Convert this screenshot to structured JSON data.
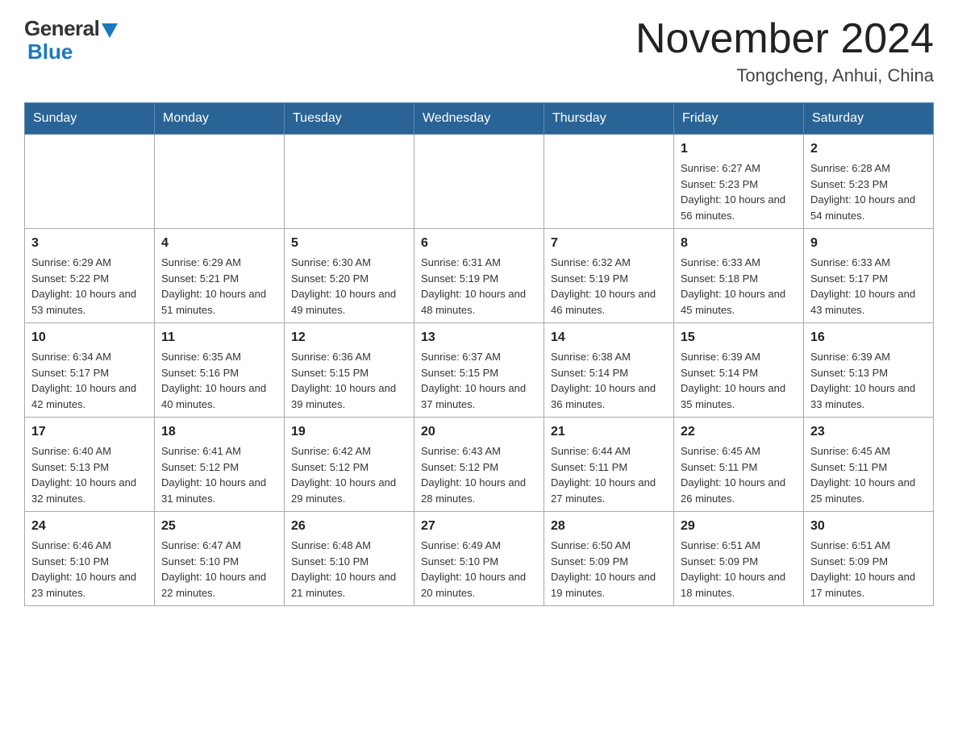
{
  "header": {
    "logo_general": "General",
    "logo_blue": "Blue",
    "month_title": "November 2024",
    "location": "Tongcheng, Anhui, China"
  },
  "weekdays": [
    "Sunday",
    "Monday",
    "Tuesday",
    "Wednesday",
    "Thursday",
    "Friday",
    "Saturday"
  ],
  "weeks": [
    [
      {
        "day": "",
        "info": ""
      },
      {
        "day": "",
        "info": ""
      },
      {
        "day": "",
        "info": ""
      },
      {
        "day": "",
        "info": ""
      },
      {
        "day": "",
        "info": ""
      },
      {
        "day": "1",
        "info": "Sunrise: 6:27 AM\nSunset: 5:23 PM\nDaylight: 10 hours and 56 minutes."
      },
      {
        "day": "2",
        "info": "Sunrise: 6:28 AM\nSunset: 5:23 PM\nDaylight: 10 hours and 54 minutes."
      }
    ],
    [
      {
        "day": "3",
        "info": "Sunrise: 6:29 AM\nSunset: 5:22 PM\nDaylight: 10 hours and 53 minutes."
      },
      {
        "day": "4",
        "info": "Sunrise: 6:29 AM\nSunset: 5:21 PM\nDaylight: 10 hours and 51 minutes."
      },
      {
        "day": "5",
        "info": "Sunrise: 6:30 AM\nSunset: 5:20 PM\nDaylight: 10 hours and 49 minutes."
      },
      {
        "day": "6",
        "info": "Sunrise: 6:31 AM\nSunset: 5:19 PM\nDaylight: 10 hours and 48 minutes."
      },
      {
        "day": "7",
        "info": "Sunrise: 6:32 AM\nSunset: 5:19 PM\nDaylight: 10 hours and 46 minutes."
      },
      {
        "day": "8",
        "info": "Sunrise: 6:33 AM\nSunset: 5:18 PM\nDaylight: 10 hours and 45 minutes."
      },
      {
        "day": "9",
        "info": "Sunrise: 6:33 AM\nSunset: 5:17 PM\nDaylight: 10 hours and 43 minutes."
      }
    ],
    [
      {
        "day": "10",
        "info": "Sunrise: 6:34 AM\nSunset: 5:17 PM\nDaylight: 10 hours and 42 minutes."
      },
      {
        "day": "11",
        "info": "Sunrise: 6:35 AM\nSunset: 5:16 PM\nDaylight: 10 hours and 40 minutes."
      },
      {
        "day": "12",
        "info": "Sunrise: 6:36 AM\nSunset: 5:15 PM\nDaylight: 10 hours and 39 minutes."
      },
      {
        "day": "13",
        "info": "Sunrise: 6:37 AM\nSunset: 5:15 PM\nDaylight: 10 hours and 37 minutes."
      },
      {
        "day": "14",
        "info": "Sunrise: 6:38 AM\nSunset: 5:14 PM\nDaylight: 10 hours and 36 minutes."
      },
      {
        "day": "15",
        "info": "Sunrise: 6:39 AM\nSunset: 5:14 PM\nDaylight: 10 hours and 35 minutes."
      },
      {
        "day": "16",
        "info": "Sunrise: 6:39 AM\nSunset: 5:13 PM\nDaylight: 10 hours and 33 minutes."
      }
    ],
    [
      {
        "day": "17",
        "info": "Sunrise: 6:40 AM\nSunset: 5:13 PM\nDaylight: 10 hours and 32 minutes."
      },
      {
        "day": "18",
        "info": "Sunrise: 6:41 AM\nSunset: 5:12 PM\nDaylight: 10 hours and 31 minutes."
      },
      {
        "day": "19",
        "info": "Sunrise: 6:42 AM\nSunset: 5:12 PM\nDaylight: 10 hours and 29 minutes."
      },
      {
        "day": "20",
        "info": "Sunrise: 6:43 AM\nSunset: 5:12 PM\nDaylight: 10 hours and 28 minutes."
      },
      {
        "day": "21",
        "info": "Sunrise: 6:44 AM\nSunset: 5:11 PM\nDaylight: 10 hours and 27 minutes."
      },
      {
        "day": "22",
        "info": "Sunrise: 6:45 AM\nSunset: 5:11 PM\nDaylight: 10 hours and 26 minutes."
      },
      {
        "day": "23",
        "info": "Sunrise: 6:45 AM\nSunset: 5:11 PM\nDaylight: 10 hours and 25 minutes."
      }
    ],
    [
      {
        "day": "24",
        "info": "Sunrise: 6:46 AM\nSunset: 5:10 PM\nDaylight: 10 hours and 23 minutes."
      },
      {
        "day": "25",
        "info": "Sunrise: 6:47 AM\nSunset: 5:10 PM\nDaylight: 10 hours and 22 minutes."
      },
      {
        "day": "26",
        "info": "Sunrise: 6:48 AM\nSunset: 5:10 PM\nDaylight: 10 hours and 21 minutes."
      },
      {
        "day": "27",
        "info": "Sunrise: 6:49 AM\nSunset: 5:10 PM\nDaylight: 10 hours and 20 minutes."
      },
      {
        "day": "28",
        "info": "Sunrise: 6:50 AM\nSunset: 5:09 PM\nDaylight: 10 hours and 19 minutes."
      },
      {
        "day": "29",
        "info": "Sunrise: 6:51 AM\nSunset: 5:09 PM\nDaylight: 10 hours and 18 minutes."
      },
      {
        "day": "30",
        "info": "Sunrise: 6:51 AM\nSunset: 5:09 PM\nDaylight: 10 hours and 17 minutes."
      }
    ]
  ]
}
